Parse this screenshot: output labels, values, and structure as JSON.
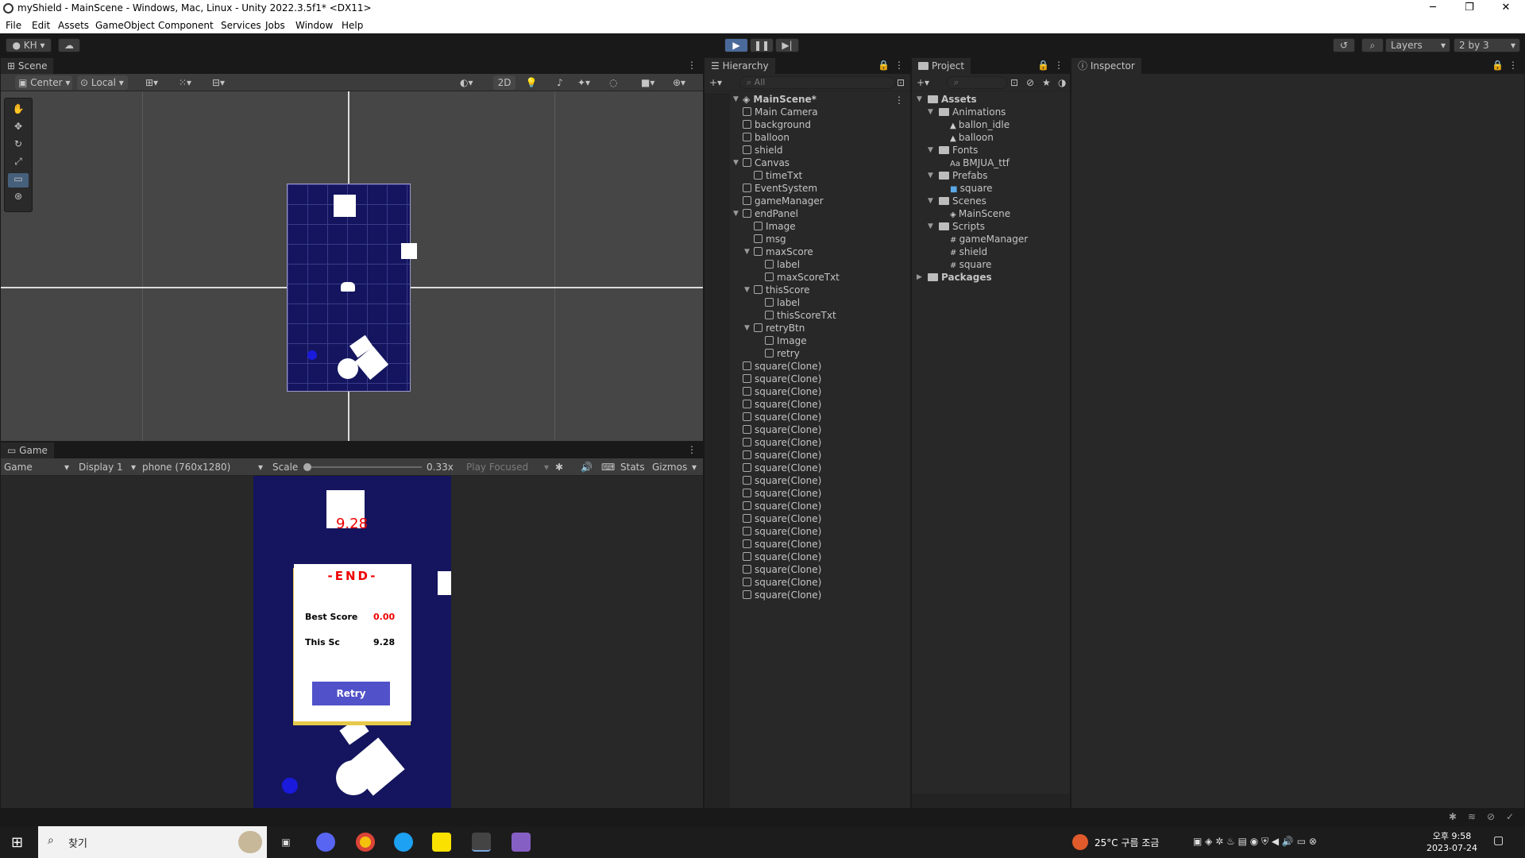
{
  "window": {
    "title": "myShield - MainScene - Windows, Mac, Linux - Unity 2022.3.5f1* <DX11>",
    "min": "─",
    "max": "❐",
    "close": "✕"
  },
  "menu": [
    "File",
    "Edit",
    "Assets",
    "GameObject",
    "Component",
    "Services",
    "Jobs",
    "Window",
    "Help"
  ],
  "toolbar": {
    "account": "KH",
    "layers": "Layers",
    "layout": "2 by 3"
  },
  "scene": {
    "tab": "Scene",
    "pivot": "Center",
    "space": "Local",
    "mode2d": "2D"
  },
  "game": {
    "tab": "Game",
    "view": "Game",
    "display": "Display 1",
    "resolution": "phone (760x1280)",
    "scale_label": "Scale",
    "scale_value": "0.33x",
    "play_mode": "Play Focused",
    "stats": "Stats",
    "gizmos": "Gizmos",
    "timer": "9.28",
    "end_title": "-END-",
    "best_label": "Best Score",
    "best_value": "0.00",
    "this_label": "This Sc",
    "this_value": "9.28",
    "retry": "Retry"
  },
  "hierarchy": {
    "tab": "Hierarchy",
    "search": "All",
    "root": "MainScene*",
    "items": [
      "Main Camera",
      "background",
      "balloon",
      "shield",
      "Canvas",
      "timeTxt",
      "EventSystem",
      "gameManager",
      "endPanel",
      "Image",
      "msg",
      "maxScore",
      "label",
      "maxScoreTxt",
      "thisScore",
      "label",
      "thisScoreTxt",
      "retryBtn",
      "Image",
      "retry",
      "square(Clone)",
      "square(Clone)",
      "square(Clone)",
      "square(Clone)",
      "square(Clone)",
      "square(Clone)",
      "square(Clone)",
      "square(Clone)",
      "square(Clone)",
      "square(Clone)",
      "square(Clone)",
      "square(Clone)",
      "square(Clone)",
      "square(Clone)",
      "square(Clone)",
      "square(Clone)",
      "square(Clone)",
      "square(Clone)",
      "square(Clone)"
    ]
  },
  "project": {
    "tab": "Project",
    "items": [
      "Assets",
      "Animations",
      "ballon_idle",
      "balloon",
      "Fonts",
      "BMJUA_ttf",
      "Prefabs",
      "square",
      "Scenes",
      "MainScene",
      "Scripts",
      "gameManager",
      "shield",
      "square",
      "Packages"
    ]
  },
  "inspector": {
    "tab": "Inspector"
  },
  "taskbar": {
    "search": "찾기",
    "weather": "25°C 구름 조금",
    "time": "오후 9:58",
    "date": "2023-07-24"
  }
}
